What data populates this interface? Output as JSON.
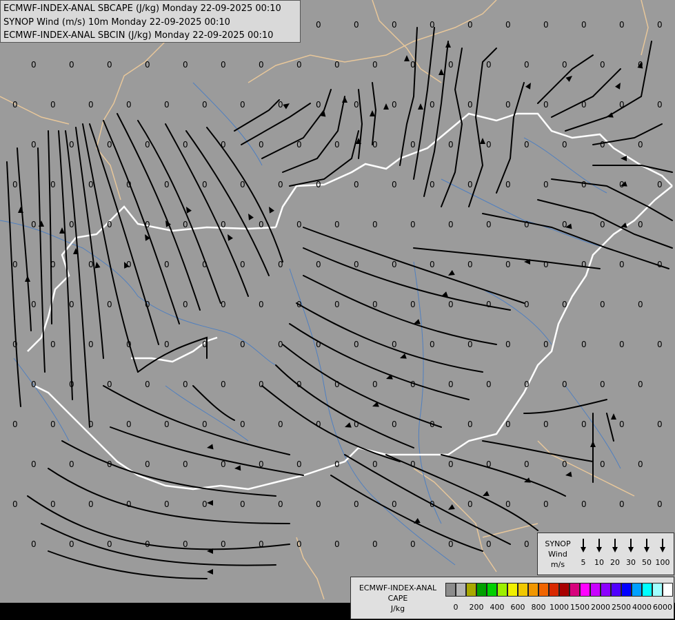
{
  "title": {
    "line1": "ECMWF-INDEX-ANAL SBCAPE (J/kg) Monday 22-09-2025 00:10",
    "line2": "SYNOP Wind (m/s) 10m Monday 22-09-2025 00:10",
    "line3": "ECMWF-INDEX-ANAL SBCIN (J/kg) Monday 22-09-2025 00:10"
  },
  "map": {
    "background_color": "#9b9b9b",
    "field_value_label": "0",
    "colors": {
      "border_country": "#ffffff",
      "border_region": "#e8c79a",
      "rivers": "#4f7fc0",
      "streamlines": "#000000"
    }
  },
  "wind_legend": {
    "line1": "SYNOP",
    "line2": "Wind",
    "line3": "m/s",
    "speeds": [
      "5",
      "10",
      "20",
      "30",
      "50",
      "100"
    ]
  },
  "cape_legend": {
    "line1": "ECMWF-INDEX-ANAL",
    "line2": "CAPE",
    "line3": "J/kg",
    "colors": [
      "#8c8c8c",
      "#b4b4b4",
      "#a8a800",
      "#00a000",
      "#00d000",
      "#9cf000",
      "#f0f000",
      "#f0c800",
      "#f09600",
      "#f06400",
      "#d82800",
      "#a80000",
      "#d8007c",
      "#ff00ff",
      "#c800ff",
      "#8c00ff",
      "#5000ff",
      "#0000ff",
      "#00a0ff",
      "#00ffff",
      "#a0ffff",
      "#ffffff"
    ],
    "ticks": [
      "0",
      "200",
      "400",
      "600",
      "800",
      "1000",
      "1500",
      "2000",
      "2500",
      "4000",
      "6000"
    ]
  }
}
